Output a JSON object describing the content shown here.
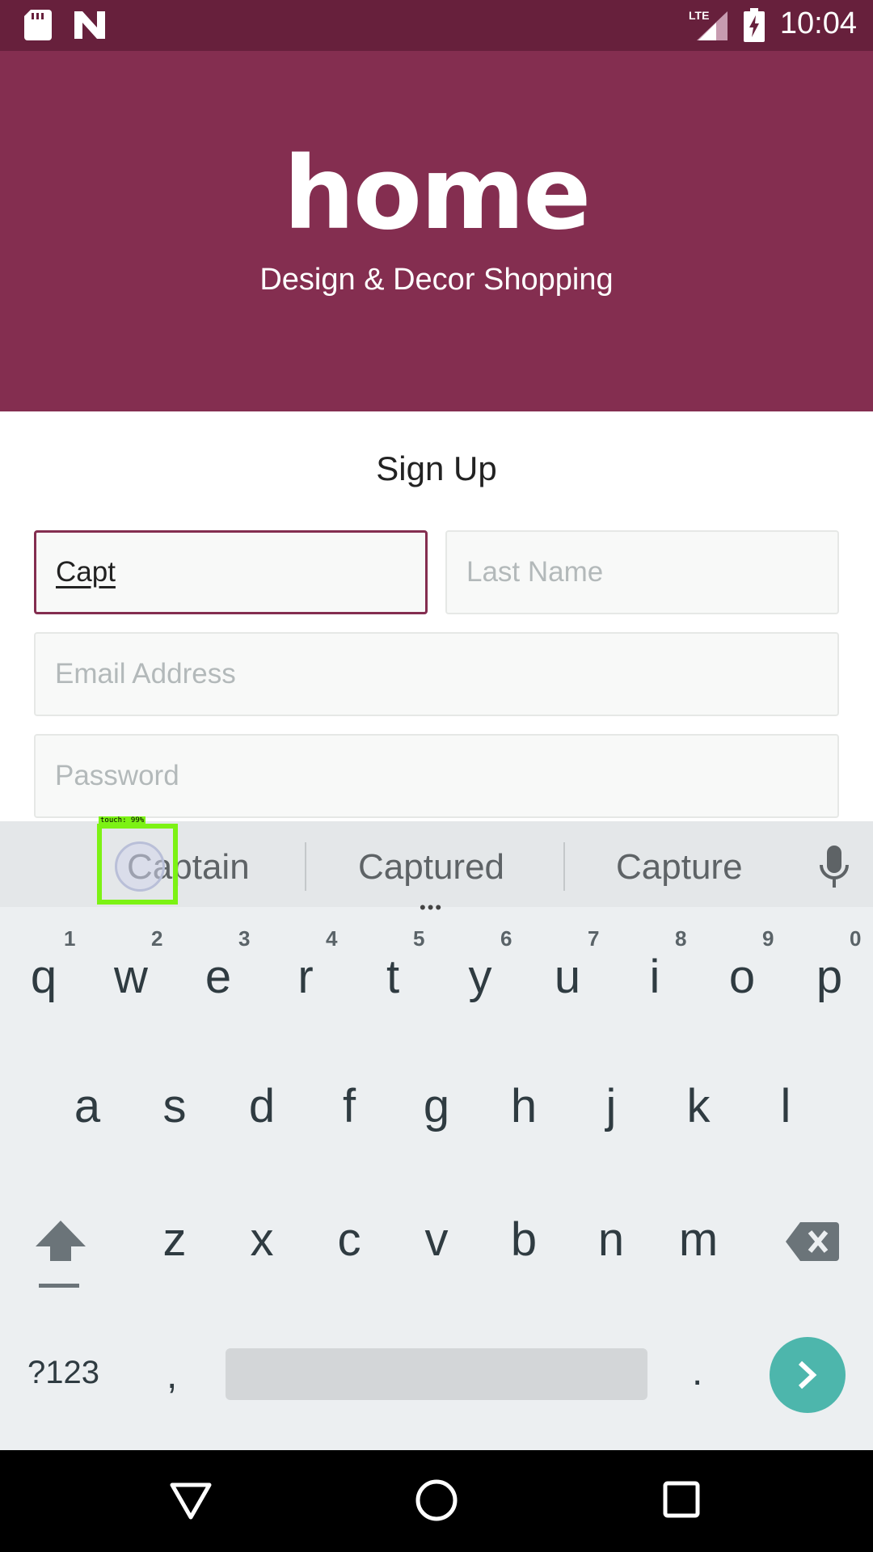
{
  "status_bar": {
    "time": "10:04",
    "network": "LTE",
    "icons": [
      "sd-card-icon",
      "n-app-icon",
      "signal-icon",
      "battery-charging-icon"
    ]
  },
  "header": {
    "logo": "home",
    "tagline": "Design & Decor Shopping"
  },
  "form": {
    "title": "Sign Up",
    "first_name_value": "Capt",
    "last_name_placeholder": "Last Name",
    "email_placeholder": "Email Address",
    "password_placeholder": "Password"
  },
  "keyboard": {
    "suggestions": [
      "Captain",
      "Captured",
      "Capture"
    ],
    "more_indicator": "•••",
    "row1": [
      "q",
      "w",
      "e",
      "r",
      "t",
      "y",
      "u",
      "i",
      "o",
      "p"
    ],
    "row1_hints": [
      "1",
      "2",
      "3",
      "4",
      "5",
      "6",
      "7",
      "8",
      "9",
      "0"
    ],
    "row2": [
      "a",
      "s",
      "d",
      "f",
      "g",
      "h",
      "j",
      "k",
      "l"
    ],
    "row3": [
      "z",
      "x",
      "c",
      "v",
      "b",
      "n",
      "m"
    ],
    "symbols_key": "?123",
    "comma_key": ",",
    "period_key": ".",
    "icons": [
      "mic-icon",
      "shift-icon",
      "backspace-icon",
      "next-arrow-icon"
    ]
  },
  "touch_overlay": {
    "label": "touch: 99%"
  },
  "nav_bar": {
    "icons": [
      "back-icon",
      "home-icon",
      "recents-icon"
    ]
  },
  "colors": {
    "status_bar": "#67203c",
    "header": "#842e50",
    "accent": "#842e50",
    "enter_key": "#4db6ac",
    "touch_box": "#7cf214"
  }
}
